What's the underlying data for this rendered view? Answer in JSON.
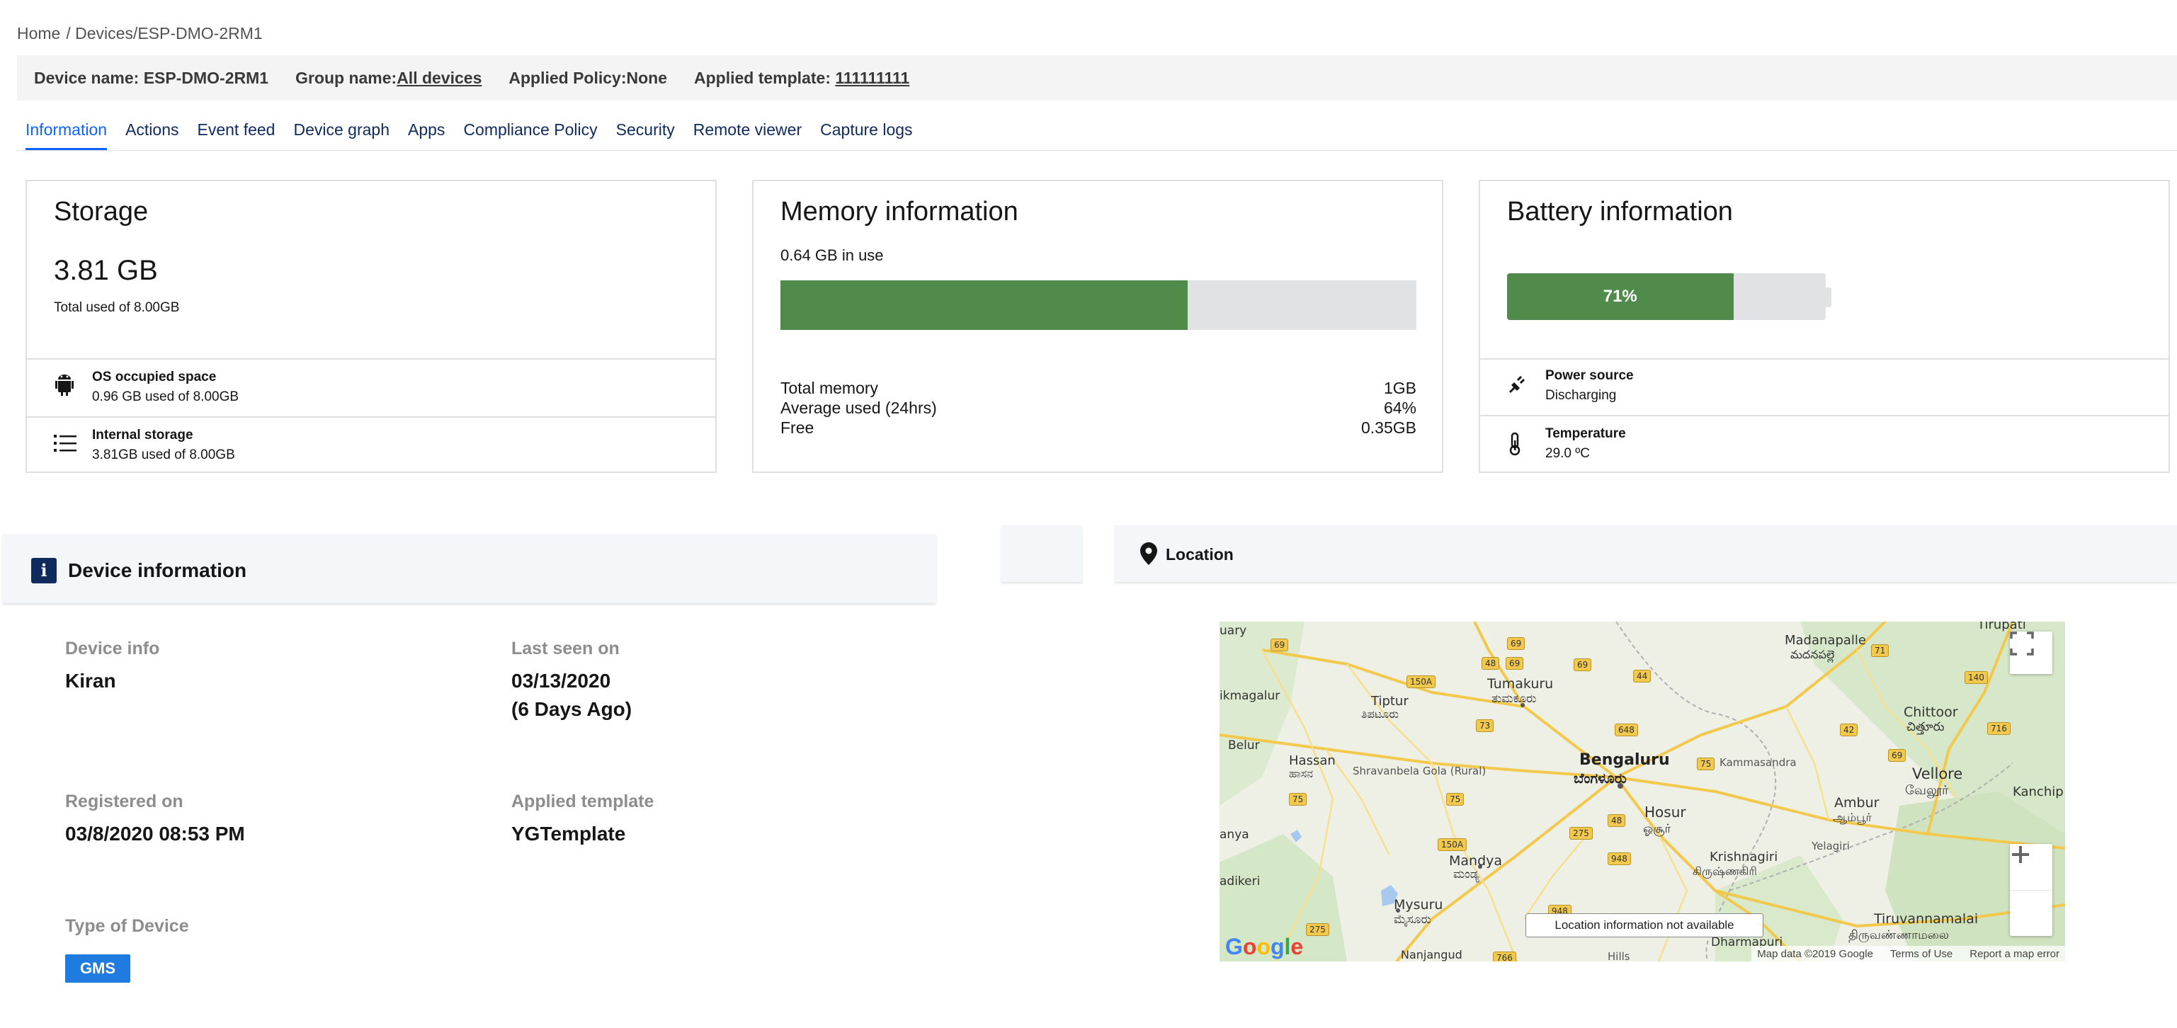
{
  "breadcrumb": {
    "home": "Home",
    "devices": "/ Devices",
    "current": "/ESP-DMO-2RM1"
  },
  "header": {
    "device_name_label": "Device name:",
    "device_name": "ESP-DMO-2RM1",
    "group_label": "Group name:",
    "group_value": "All devices",
    "policy_label": "Applied Policy:",
    "policy_value": "None",
    "template_label": "Applied template:",
    "template_value": "111111111"
  },
  "tabs": [
    {
      "label": "Information",
      "active": true
    },
    {
      "label": "Actions"
    },
    {
      "label": "Event feed"
    },
    {
      "label": "Device graph"
    },
    {
      "label": "Apps"
    },
    {
      "label": "Compliance Policy"
    },
    {
      "label": "Security"
    },
    {
      "label": "Remote viewer"
    },
    {
      "label": "Capture logs"
    }
  ],
  "storage": {
    "title": "Storage",
    "total": "3.81 GB",
    "total_sub": "Total used of 8.00GB",
    "os_title": "OS occupied space",
    "os_value": "0.96 GB used of 8.00GB",
    "internal_title": "Internal storage",
    "internal_value": "3.81GB used of 8.00GB"
  },
  "memory": {
    "title": "Memory information",
    "in_use": "0.64 GB in use",
    "used_fraction": 0.64,
    "stats": [
      {
        "label": "Total memory",
        "value": "1GB"
      },
      {
        "label": "Average used (24hrs)",
        "value": "64%"
      },
      {
        "label": "Free",
        "value": "0.35GB"
      }
    ]
  },
  "battery": {
    "title": "Battery information",
    "percent_label": "71%",
    "level": 0.71,
    "power_title": "Power source",
    "power_value": "Discharging",
    "temp_title": "Temperature",
    "temp_value": "29.0 ºC"
  },
  "device_info": {
    "title": "Device information",
    "device_info_label": "Device info",
    "device_info_value": "Kiran",
    "last_seen_label": "Last seen on",
    "last_seen_date": "03/13/2020",
    "last_seen_ago": "(6 Days Ago)",
    "registered_label": "Registered on",
    "registered_value": "03/8/2020 08:53 PM",
    "template_label": "Applied template",
    "template_value": "YGTemplate",
    "type_label": "Type of Device",
    "type_value": "GMS"
  },
  "location": {
    "title": "Location",
    "tooltip": "Location information not available",
    "map_data": "Map data ©2019 Google",
    "terms": "Terms of Use",
    "report": "Report a map error",
    "places": [
      {
        "name": "Bengaluru"
      },
      {
        "name": "ಬೆಂಗಳೂರು"
      },
      {
        "name": "Tumakuru"
      },
      {
        "name": "ತುಮಕೂರು"
      },
      {
        "name": "Mysuru"
      },
      {
        "name": "ಮೈಸೂರು"
      },
      {
        "name": "Mandya"
      },
      {
        "name": "ಮಂಡ್ಯ"
      },
      {
        "name": "Hosur"
      },
      {
        "name": "ஓசூர்"
      },
      {
        "name": "Hassan"
      },
      {
        "name": "ಹಾಸನ"
      },
      {
        "name": "Vellore"
      },
      {
        "name": "வேலூர்"
      },
      {
        "name": "Chittoor"
      },
      {
        "name": "చిత్తూరు"
      },
      {
        "name": "Madanapalle"
      },
      {
        "name": "మదనపల్లె"
      },
      {
        "name": "Krishnagiri"
      },
      {
        "name": "கிருஷ்ணகிரி"
      },
      {
        "name": "Ambur"
      },
      {
        "name": "ஆம்பூர்"
      },
      {
        "name": "Tiptur"
      },
      {
        "name": "ತಿಪಟೂರು"
      },
      {
        "name": "Tiruvannamalai"
      },
      {
        "name": "திருவண்ணாமலை"
      },
      {
        "name": "Kammasandra"
      },
      {
        "name": "Shravanbela Gola (Rural)"
      },
      {
        "name": "Nanjangud"
      },
      {
        "name": "Dharmapuri"
      },
      {
        "name": "Kanchip"
      },
      {
        "name": "Tirupati"
      },
      {
        "name": "ikmagalur"
      },
      {
        "name": "Belur"
      },
      {
        "name": "adikeri"
      },
      {
        "name": "uary"
      },
      {
        "name": "anya"
      },
      {
        "name": "Hills"
      },
      {
        "name": "Yelagiri"
      }
    ],
    "road_labels": [
      "69",
      "69",
      "69",
      "48",
      "69",
      "150A",
      "44",
      "71",
      "140",
      "73",
      "648",
      "42",
      "69",
      "716",
      "75",
      "75",
      "75",
      "48",
      "150A",
      "275",
      "948",
      "948",
      "275",
      "766"
    ]
  },
  "colors": {
    "accent": "#0f62fe",
    "navy": "#0f2a5c",
    "bar_green": "#508b4b",
    "bar_track": "#e0e2e4",
    "badge_blue": "#1f7be0"
  }
}
